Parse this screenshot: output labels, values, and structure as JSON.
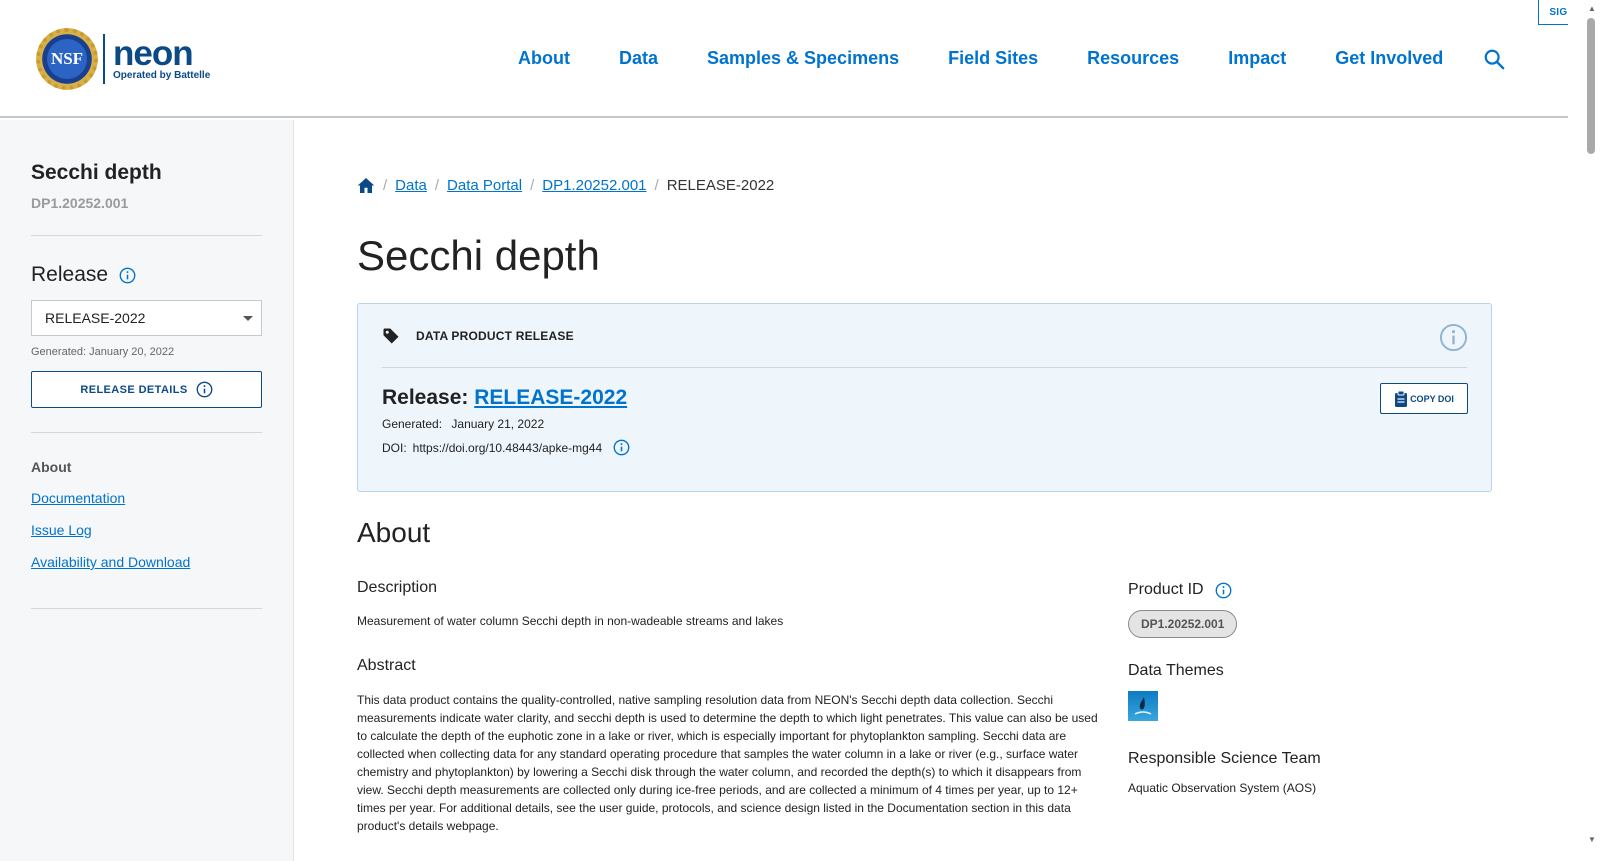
{
  "header": {
    "logo_text": "NSF",
    "brand_word": "neon",
    "brand_sub": "Operated by Battelle",
    "signin_label": "SIGN IN",
    "nav": [
      "About",
      "Data",
      "Samples & Specimens",
      "Field Sites",
      "Resources",
      "Impact",
      "Get Involved"
    ]
  },
  "sidebar": {
    "title": "Secchi depth",
    "product_id": "DP1.20252.001",
    "release_label": "Release",
    "release_selected": "RELEASE-2022",
    "generated": "Generated: January 20, 2022",
    "release_details_label": "RELEASE DETAILS",
    "section_label": "About",
    "links": [
      "Documentation",
      "Issue Log",
      "Availability and Download"
    ]
  },
  "breadcrumb": {
    "items": [
      "Data",
      "Data Portal",
      "DP1.20252.001"
    ],
    "current": "RELEASE-2022"
  },
  "main": {
    "title": "Secchi depth",
    "card": {
      "header_label": "DATA PRODUCT RELEASE",
      "release_prefix": "Release:",
      "release_link": "RELEASE-2022",
      "generated_key": "Generated:",
      "generated_value": "January 21, 2022",
      "doi_key": "DOI:",
      "doi_value": "https://doi.org/10.48443/apke-mg44",
      "copy_doi_label": "COPY DOI"
    },
    "about_heading": "About",
    "description_head": "Description",
    "description": "Measurement of water column Secchi depth in non-wadeable streams and lakes",
    "abstract_head": "Abstract",
    "abstract": "This data product contains the quality-controlled, native sampling resolution data from NEON's Secchi depth data collection. Secchi measurements indicate water clarity, and secchi depth is used to determine the depth to which light penetrates. This value can also be used to calculate the depth of the euphotic zone in a lake or river, which is especially important for phytoplankton sampling. Secchi data are collected when collecting data for any standard operating procedure that samples the water column in a lake or river (e.g., surface water chemistry and phytoplankton) by lowering a Secchi disk through the water column, and recorded the depth(s) to which it disappears from view. Secchi depth measurements are collected only during ice-free periods, and are collected a minimum of 4 times per year, up to 12+ times per year. For additional details, see the user guide, protocols, and science design listed in the Documentation section in this data product's details webpage.",
    "product_id_head": "Product ID",
    "product_id": "DP1.20252.001",
    "themes_head": "Data Themes",
    "team_head": "Responsible Science Team",
    "team_value": "Aquatic Observation System (AOS)"
  },
  "colors": {
    "link": "#0073cf",
    "brand": "#0b4a86",
    "card_bg": "#eef5fb",
    "sidebar_bg": "#f6f7f8"
  }
}
